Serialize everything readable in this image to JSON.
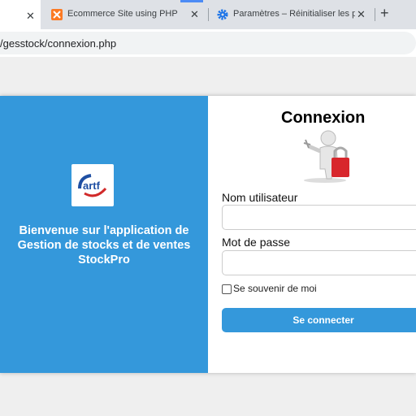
{
  "browser": {
    "tabs": [
      {
        "label": "",
        "active": true
      },
      {
        "label": "Ecommerce Site using PHP",
        "icon": "xampp-icon"
      },
      {
        "label": "Paramètres – Réinitialiser les pa",
        "icon": "gear-icon"
      }
    ],
    "close_symbol": "✕",
    "new_tab_symbol": "+",
    "url": "/gesstock/connexion.php"
  },
  "login": {
    "welcome": "Bienvenue sur l'application de Gestion de stocks et de ventes StockPro",
    "title": "Connexion",
    "username_label": "Nom utilisateur",
    "username_value": "",
    "password_label": "Mot de passe",
    "password_value": "",
    "remember_label": "Se souvenir de moi",
    "submit_label": "Se connecter"
  },
  "colors": {
    "accent": "#3498db",
    "tabstrip": "#dee1e6"
  }
}
